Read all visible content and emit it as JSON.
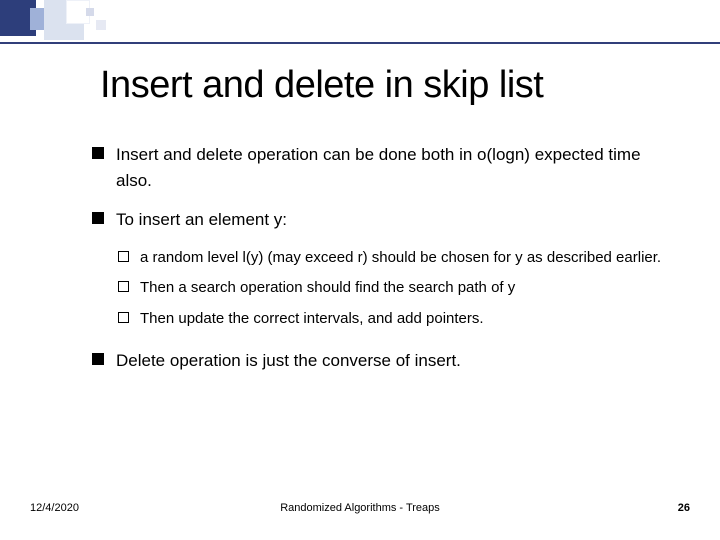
{
  "title": "Insert and delete in skip list",
  "bullets": {
    "b1": "Insert and delete operation can be done both in o(logn) expected time also.",
    "b2": "To insert an element y:",
    "b2a": "a random level l(y) (may exceed r) should be chosen for y as described earlier.",
    "b2b": "Then a search operation should find the search path of y",
    "b2c": "Then update the correct intervals, and add pointers.",
    "b3": "Delete operation is just the converse of insert."
  },
  "footer": {
    "date": "12/4/2020",
    "center": "Randomized Algorithms - Treaps",
    "page": "26"
  }
}
